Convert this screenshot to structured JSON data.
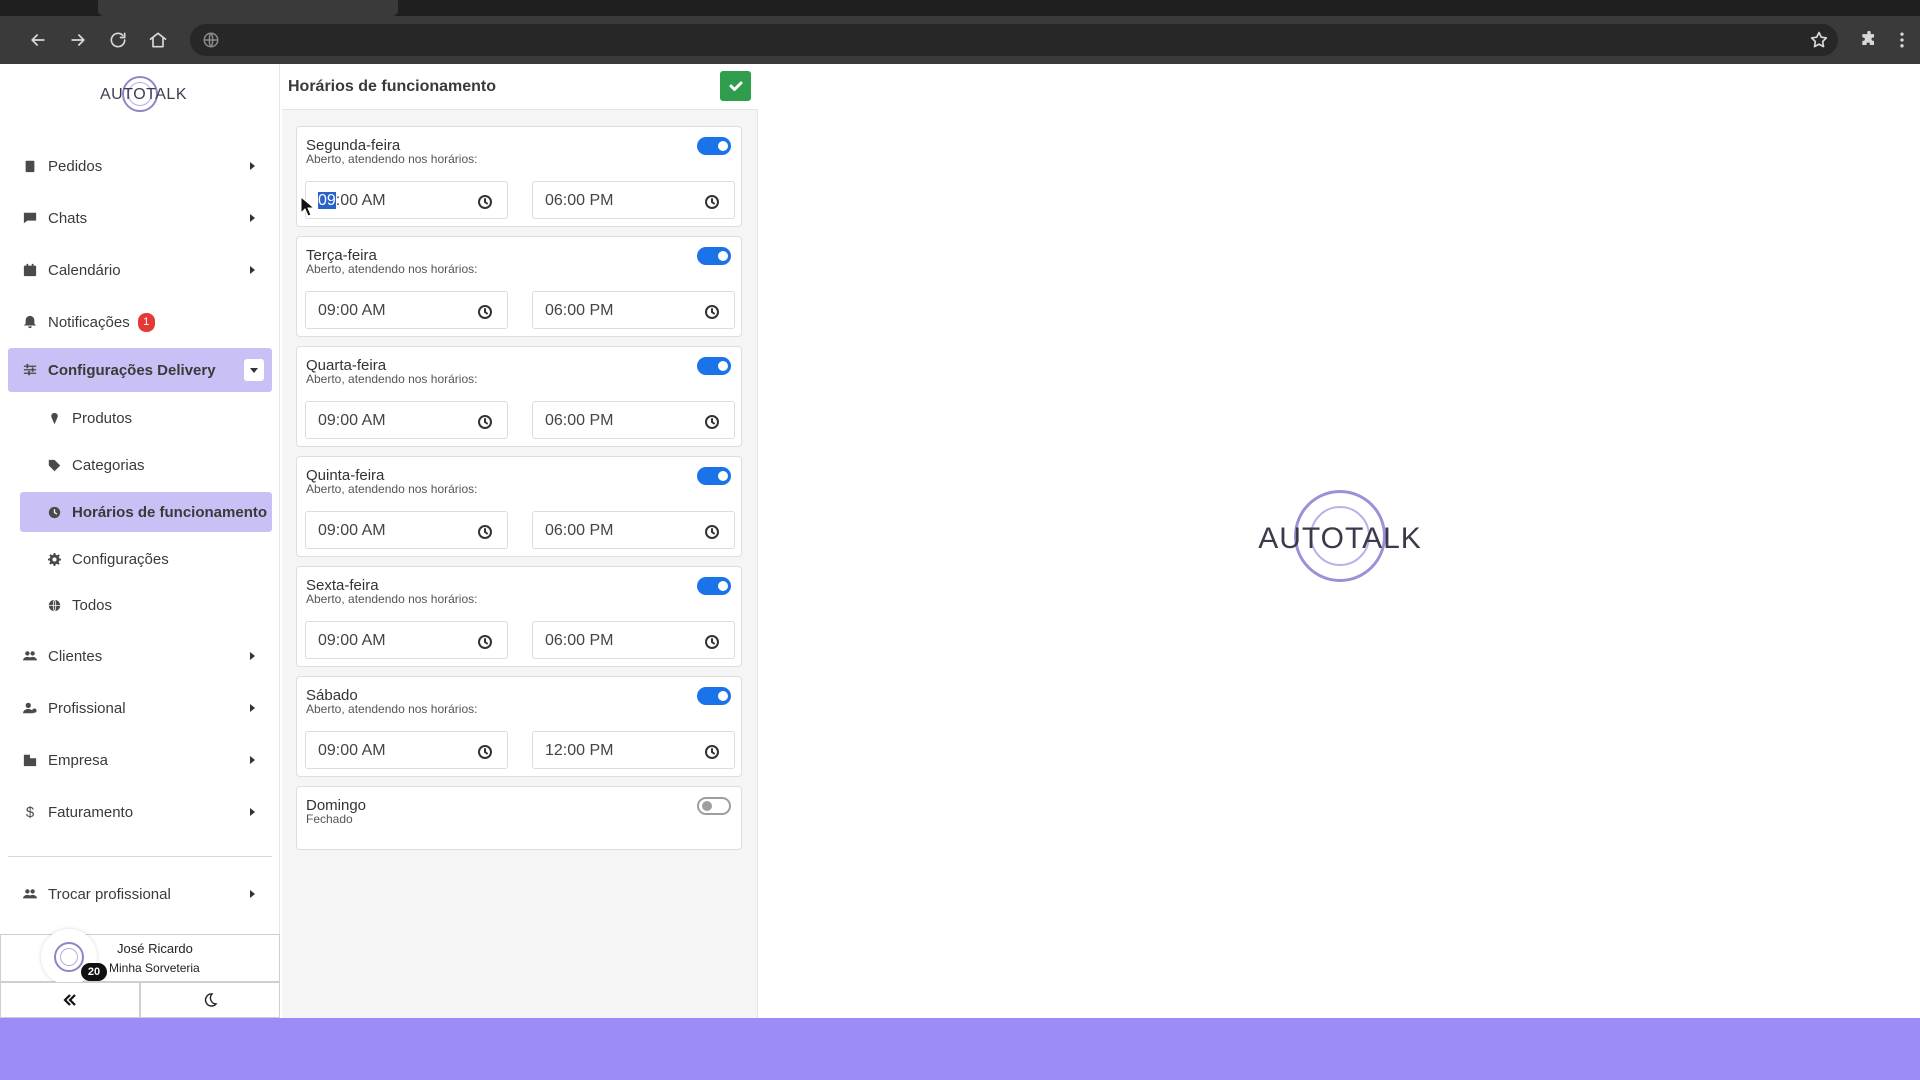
{
  "browser": {
    "back_icon": "arrow-left-icon",
    "forward_icon": "arrow-right-icon",
    "reload_icon": "reload-icon",
    "home_icon": "home-icon",
    "site_icon": "globe-icon",
    "bookmark_icon": "star-icon",
    "extensions_icon": "puzzle-icon",
    "menu_icon": "kebab-menu-icon"
  },
  "brand": {
    "logo_text": "AUTOTALK",
    "accent_color": "#9b8cf8",
    "active_bg": "#c9c1f5"
  },
  "sidebar": {
    "items": [
      {
        "label": "Pedidos",
        "icon": "clipboard-icon"
      },
      {
        "label": "Chats",
        "icon": "chat-icon"
      },
      {
        "label": "Calendário",
        "icon": "calendar-icon"
      },
      {
        "label": "Notificações",
        "icon": "bell-icon",
        "badge": "1"
      },
      {
        "label": "Configurações Delivery",
        "icon": "sliders-icon",
        "expanded": true
      },
      {
        "label": "Clientes",
        "icon": "users-icon"
      },
      {
        "label": "Profissional",
        "icon": "user-gear-icon"
      },
      {
        "label": "Empresa",
        "icon": "building-icon"
      },
      {
        "label": "Faturamento",
        "icon": "dollar-icon"
      },
      {
        "label": "Trocar profissional",
        "icon": "users-swap-icon"
      }
    ],
    "sub_items": [
      {
        "label": "Produtos",
        "icon": "ice-cream-icon"
      },
      {
        "label": "Categorias",
        "icon": "tag-icon"
      },
      {
        "label": "Horários de funcionamento",
        "icon": "clock-icon",
        "active": true
      },
      {
        "label": "Configurações",
        "icon": "gear-icon"
      },
      {
        "label": "Todos",
        "icon": "globe-icon"
      }
    ],
    "user": {
      "name": "José Ricardo",
      "store": "Minha Sorveteria",
      "count": "20"
    },
    "collapse_icon": "double-chevron-left-icon",
    "theme_icon": "moon-icon"
  },
  "schedule": {
    "title": "Horários de funcionamento",
    "save_icon": "check-icon",
    "days": [
      {
        "name": "Segunda-feira",
        "status": "Aberto, atendendo nos horários:",
        "enabled": true,
        "start": "09:00 AM",
        "end": "06:00 PM"
      },
      {
        "name": "Terça-feira",
        "status": "Aberto, atendendo nos horários:",
        "enabled": true,
        "start": "09:00 AM",
        "end": "06:00 PM"
      },
      {
        "name": "Quarta-feira",
        "status": "Aberto, atendendo nos horários:",
        "enabled": true,
        "start": "09:00 AM",
        "end": "06:00 PM"
      },
      {
        "name": "Quinta-feira",
        "status": "Aberto, atendendo nos horários:",
        "enabled": true,
        "start": "09:00 AM",
        "end": "06:00 PM"
      },
      {
        "name": "Sexta-feira",
        "status": "Aberto, atendendo nos horários:",
        "enabled": true,
        "start": "09:00 AM",
        "end": "06:00 PM"
      },
      {
        "name": "Sábado",
        "status": "Aberto, atendendo nos horários:",
        "enabled": true,
        "start": "09:00 AM",
        "end": "12:00 PM"
      },
      {
        "name": "Domingo",
        "status": "Fechado",
        "enabled": false
      }
    ],
    "first_start_hour_selected": "09",
    "first_start_rest": ":00 AM"
  }
}
